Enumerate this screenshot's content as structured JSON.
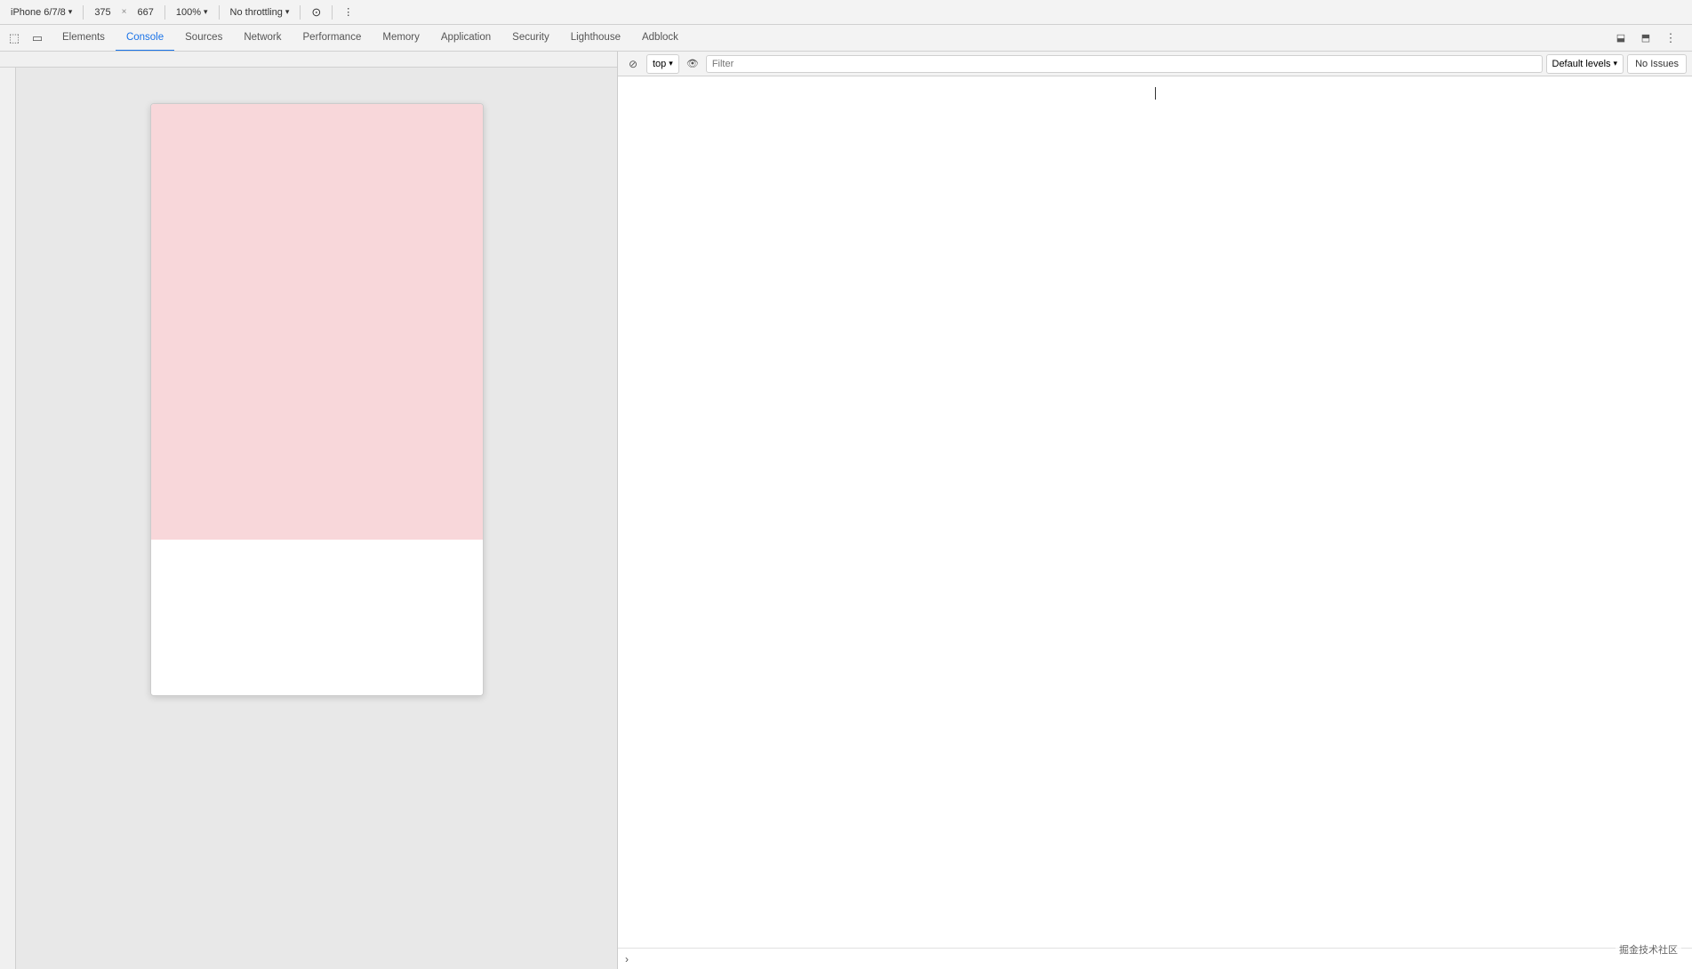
{
  "toolbar": {
    "device": "iPhone 6/7/8",
    "width": "375",
    "height": "667",
    "zoom": "100%",
    "throttling": "No throttling",
    "more_icon": "⋮"
  },
  "tabs": {
    "items": [
      {
        "id": "elements",
        "label": "Elements",
        "active": false
      },
      {
        "id": "console",
        "label": "Console",
        "active": true
      },
      {
        "id": "sources",
        "label": "Sources",
        "active": false
      },
      {
        "id": "network",
        "label": "Network",
        "active": false
      },
      {
        "id": "performance",
        "label": "Performance",
        "active": false
      },
      {
        "id": "memory",
        "label": "Memory",
        "active": false
      },
      {
        "id": "application",
        "label": "Application",
        "active": false
      },
      {
        "id": "security",
        "label": "Security",
        "active": false
      },
      {
        "id": "lighthouse",
        "label": "Lighthouse",
        "active": false
      },
      {
        "id": "adblock",
        "label": "Adblock",
        "active": false
      }
    ]
  },
  "console_toolbar": {
    "top_label": "top",
    "filter_placeholder": "Filter",
    "default_levels_label": "Default levels",
    "no_issues_label": "No Issues"
  },
  "icons": {
    "inspect": "⬚",
    "device_toggle": "▭",
    "no_entry": "⊘",
    "eye": "👁",
    "chevron_down": "▾",
    "chevron_right": "›",
    "dock_bottom": "⬓",
    "dock_right": "⬒",
    "more": "⋮",
    "cursor": "|"
  },
  "watermark": "掘金技术社区"
}
